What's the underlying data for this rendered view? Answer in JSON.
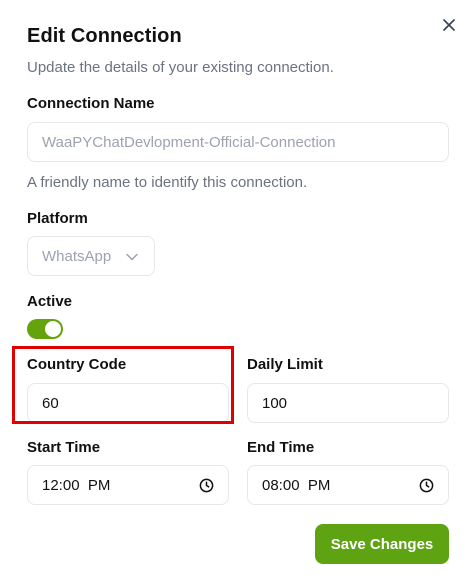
{
  "dialog": {
    "title": "Edit Connection",
    "description": "Update the details of your existing connection.",
    "close_icon": "close-icon"
  },
  "connection_name": {
    "label": "Connection Name",
    "value": "WaaPYChatDevlopment-Official-Connection",
    "hint": "A friendly name to identify this connection."
  },
  "platform": {
    "label": "Platform",
    "selected": "WhatsApp",
    "icon": "chevron-down-icon"
  },
  "active": {
    "label": "Active",
    "on": true,
    "color": "#65a30d"
  },
  "country_code": {
    "label": "Country Code",
    "value": "60"
  },
  "daily_limit": {
    "label": "Daily Limit",
    "value": "100"
  },
  "start_time": {
    "label": "Start Time",
    "value": "12:00  PM",
    "icon": "clock-icon"
  },
  "end_time": {
    "label": "End Time",
    "value": "08:00  PM",
    "icon": "clock-icon"
  },
  "actions": {
    "save_label": "Save Changes",
    "save_color": "#5ea311"
  },
  "highlight_color": "#e00000"
}
